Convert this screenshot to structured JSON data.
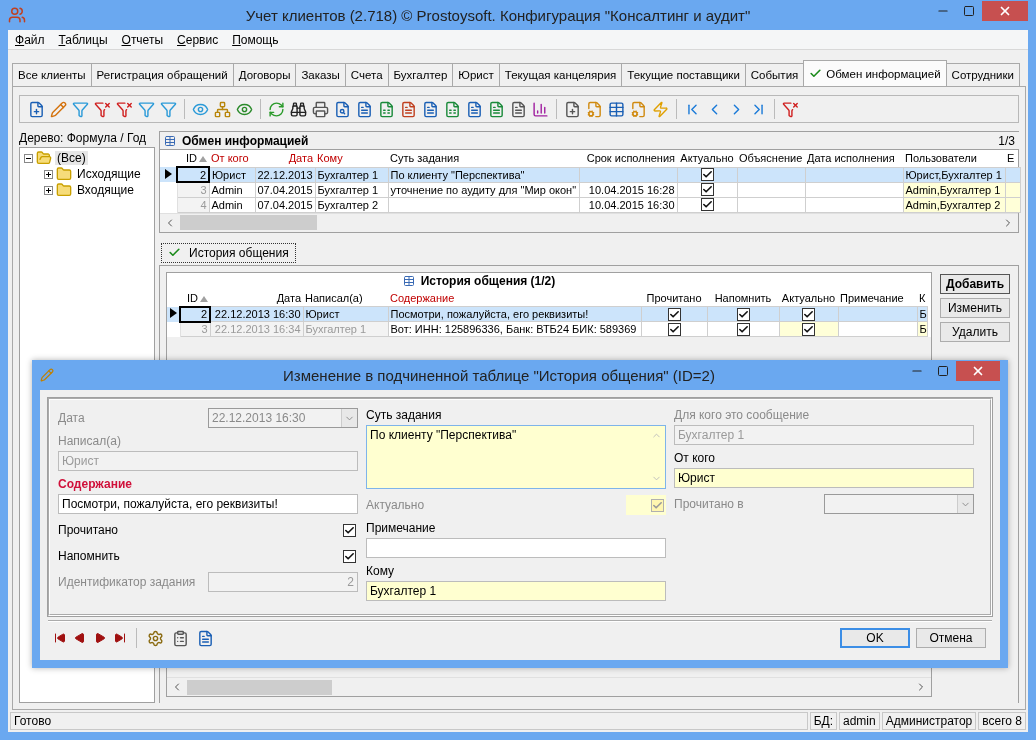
{
  "window": {
    "title": "Учет клиентов (2.718) © Prostoysoft. Конфигурация \"Консалтинг и аудит\""
  },
  "menu": [
    "Файл",
    "Таблицы",
    "Отчеты",
    "Сервис",
    "Помощь"
  ],
  "tabs": [
    {
      "label": "Все клиенты",
      "selected": false
    },
    {
      "label": "Регистрация обращений",
      "selected": false
    },
    {
      "label": "Договоры",
      "selected": false
    },
    {
      "label": "Заказы",
      "selected": false
    },
    {
      "label": "Счета",
      "selected": false
    },
    {
      "label": "Бухгалтер",
      "selected": false
    },
    {
      "label": "Юрист",
      "selected": false
    },
    {
      "label": "Текущая канцелярия",
      "selected": false
    },
    {
      "label": "Текущие поставщики",
      "selected": false
    },
    {
      "label": "События",
      "selected": false
    },
    {
      "label": "Обмен информацией",
      "selected": true
    },
    {
      "label": "Сотрудники",
      "selected": false
    }
  ],
  "tree": {
    "title": "Дерево: Формула / Год",
    "items": [
      {
        "label": "(Все)",
        "expanded": true,
        "selected": true,
        "children": [
          {
            "label": "Исходящие",
            "expanded": false,
            "selected": false
          },
          {
            "label": "Входящие",
            "expanded": false,
            "selected": false
          }
        ]
      }
    ]
  },
  "grid": {
    "title": "Обмен информацией",
    "position": "1/3",
    "columns": [
      {
        "label": "ID",
        "kind": "number",
        "sorted": true,
        "emphasized": false,
        "muted": true,
        "shaded": false
      },
      {
        "label": "От кого",
        "kind": "text",
        "sorted": false,
        "emphasized": true,
        "muted": false,
        "shaded": false
      },
      {
        "label": "Дата",
        "kind": "date",
        "sorted": false,
        "emphasized": true,
        "muted": false,
        "shaded": false
      },
      {
        "label": "Кому",
        "kind": "text",
        "sorted": false,
        "emphasized": true,
        "muted": false,
        "shaded": false
      },
      {
        "label": "Суть задания",
        "kind": "text",
        "sorted": false,
        "emphasized": false,
        "muted": false,
        "shaded": false
      },
      {
        "label": "Срок исполнения",
        "kind": "date",
        "sorted": false,
        "emphasized": false,
        "muted": false,
        "shaded": false
      },
      {
        "label": "Актуально",
        "kind": "check",
        "sorted": false,
        "emphasized": false,
        "muted": false,
        "shaded": false
      },
      {
        "label": "Объяснение",
        "kind": "text",
        "sorted": false,
        "emphasized": false,
        "muted": false,
        "shaded": false
      },
      {
        "label": "Дата исполнения",
        "kind": "text",
        "sorted": false,
        "emphasized": false,
        "muted": false,
        "shaded": false
      },
      {
        "label": "Пользователи",
        "kind": "text",
        "sorted": false,
        "emphasized": false,
        "muted": false,
        "shaded": true
      },
      {
        "label": "E",
        "kind": "text",
        "sorted": false,
        "emphasized": false,
        "muted": false,
        "shaded": true
      }
    ],
    "rows": [
      {
        "selected": true,
        "cells": [
          "2",
          "Юрист",
          "22.12.2013",
          "Бухгалтер 1",
          "По клиенту \"Перспектива\"",
          "",
          true,
          "",
          "",
          "Юрист,Бухгалтер 1",
          ""
        ]
      },
      {
        "selected": false,
        "cells": [
          "3",
          "Admin",
          "07.04.2015",
          "Бухгалтер 1",
          "уточнение по аудиту для \"Мир окон\"",
          "10.04.2015 16:28",
          true,
          "",
          "",
          "Admin,Бухгалтер 1",
          ""
        ]
      },
      {
        "selected": false,
        "cells": [
          "4",
          "Admin",
          "07.04.2015",
          "Бухгалтер 2",
          "",
          "10.04.2015 16:30",
          true,
          "",
          "",
          "Admin,Бухгалтер 2",
          ""
        ]
      }
    ]
  },
  "subtab": {
    "label": "История общения",
    "selected": true
  },
  "subgrid": {
    "title": "История общения (1/2)",
    "columns": [
      {
        "label": "ID",
        "kind": "number",
        "sorted": true,
        "emphasized": false,
        "muted": true,
        "shaded": false
      },
      {
        "label": "Дата",
        "kind": "date",
        "sorted": false,
        "emphasized": false,
        "muted": true,
        "shaded": false
      },
      {
        "label": "Написал(а)",
        "kind": "text",
        "sorted": false,
        "emphasized": false,
        "muted": true,
        "shaded": false
      },
      {
        "label": "Содержание",
        "kind": "text",
        "sorted": false,
        "emphasized": true,
        "muted": false,
        "shaded": false
      },
      {
        "label": "Прочитано",
        "kind": "check",
        "sorted": false,
        "emphasized": false,
        "muted": false,
        "shaded": false
      },
      {
        "label": "Напомнить",
        "kind": "check",
        "sorted": false,
        "emphasized": false,
        "muted": false,
        "shaded": false
      },
      {
        "label": "Актуально",
        "kind": "check",
        "sorted": false,
        "emphasized": false,
        "muted": false,
        "shaded": true
      },
      {
        "label": "Примечание",
        "kind": "text",
        "sorted": false,
        "emphasized": false,
        "muted": false,
        "shaded": false
      },
      {
        "label": "К",
        "kind": "text",
        "sorted": false,
        "emphasized": false,
        "muted": false,
        "shaded": true
      }
    ],
    "rows": [
      {
        "selected": true,
        "cells": [
          "2",
          "22.12.2013 16:30",
          "Юрист",
          "Посмотри, пожалуйста, его реквизиты!",
          true,
          true,
          true,
          "",
          "Б"
        ]
      },
      {
        "selected": false,
        "cells": [
          "3",
          "22.12.2013 16:34",
          "Бухгалтер 1",
          "Вот: ИНН: 125896336, Банк: ВТБ24 БИК: 589369",
          true,
          true,
          true,
          "",
          "Б"
        ]
      }
    ],
    "buttons": [
      {
        "label": "Добавить",
        "default": true
      },
      {
        "label": "Изменить",
        "default": false
      },
      {
        "label": "Удалить",
        "default": false
      }
    ]
  },
  "dialog": {
    "title": "Изменение в подчиненной таблице \"История общения\" (ID=2)",
    "columns": [
      [
        {
          "kind": "dropdown",
          "label": "Дата",
          "value": "22.12.2013 16:30",
          "disabled": true,
          "required": false,
          "shaded": false
        },
        {
          "kind": "input",
          "label": "Написал(а)",
          "value": "Юрист",
          "disabled": true,
          "required": false,
          "shaded": false
        },
        {
          "kind": "input",
          "label": "Содержание",
          "value": "Посмотри, пожалуйста, его реквизиты!",
          "disabled": false,
          "required": true,
          "shaded": false
        },
        {
          "kind": "checkbox",
          "label": "Прочитано",
          "checked": true,
          "disabled": false,
          "required": false
        },
        {
          "kind": "checkbox",
          "label": "Напомнить",
          "checked": true,
          "disabled": false,
          "required": false
        },
        {
          "kind": "number",
          "label": "Идентификатор задания",
          "value": "2",
          "disabled": true,
          "required": false,
          "shaded": false
        }
      ],
      [
        {
          "kind": "textarea",
          "label": "Суть задания",
          "value": "По клиенту \"Перспектива\"",
          "disabled": false,
          "required": false,
          "shaded": true
        },
        {
          "kind": "checkbox",
          "label": "Актуально",
          "checked": true,
          "disabled": true,
          "required": false,
          "shaded": true
        },
        {
          "kind": "input",
          "label": "Примечание",
          "disabled": false,
          "required": false,
          "shaded": false
        },
        {
          "kind": "input",
          "label": "Кому",
          "value": "Бухгалтер 1",
          "disabled": false,
          "required": false,
          "shaded": true
        }
      ],
      [
        {
          "kind": "input",
          "label": "Для кого это сообщение",
          "value": "Бухгалтер 1",
          "disabled": true,
          "required": false,
          "shaded": false
        },
        {
          "kind": "input",
          "label": "От кого",
          "value": "Юрист",
          "disabled": false,
          "required": false,
          "shaded": true
        },
        {
          "kind": "dropdown",
          "label": "Прочитано в",
          "disabled": true,
          "required": false,
          "shaded": false
        }
      ]
    ],
    "buttons": [
      {
        "label": "OK",
        "default": true
      },
      {
        "label": "Отмена",
        "default": false
      }
    ]
  },
  "status_bar": {
    "message": "Готово",
    "panels": [
      "БД:",
      "admin",
      "Администратор",
      "всего 8"
    ]
  }
}
